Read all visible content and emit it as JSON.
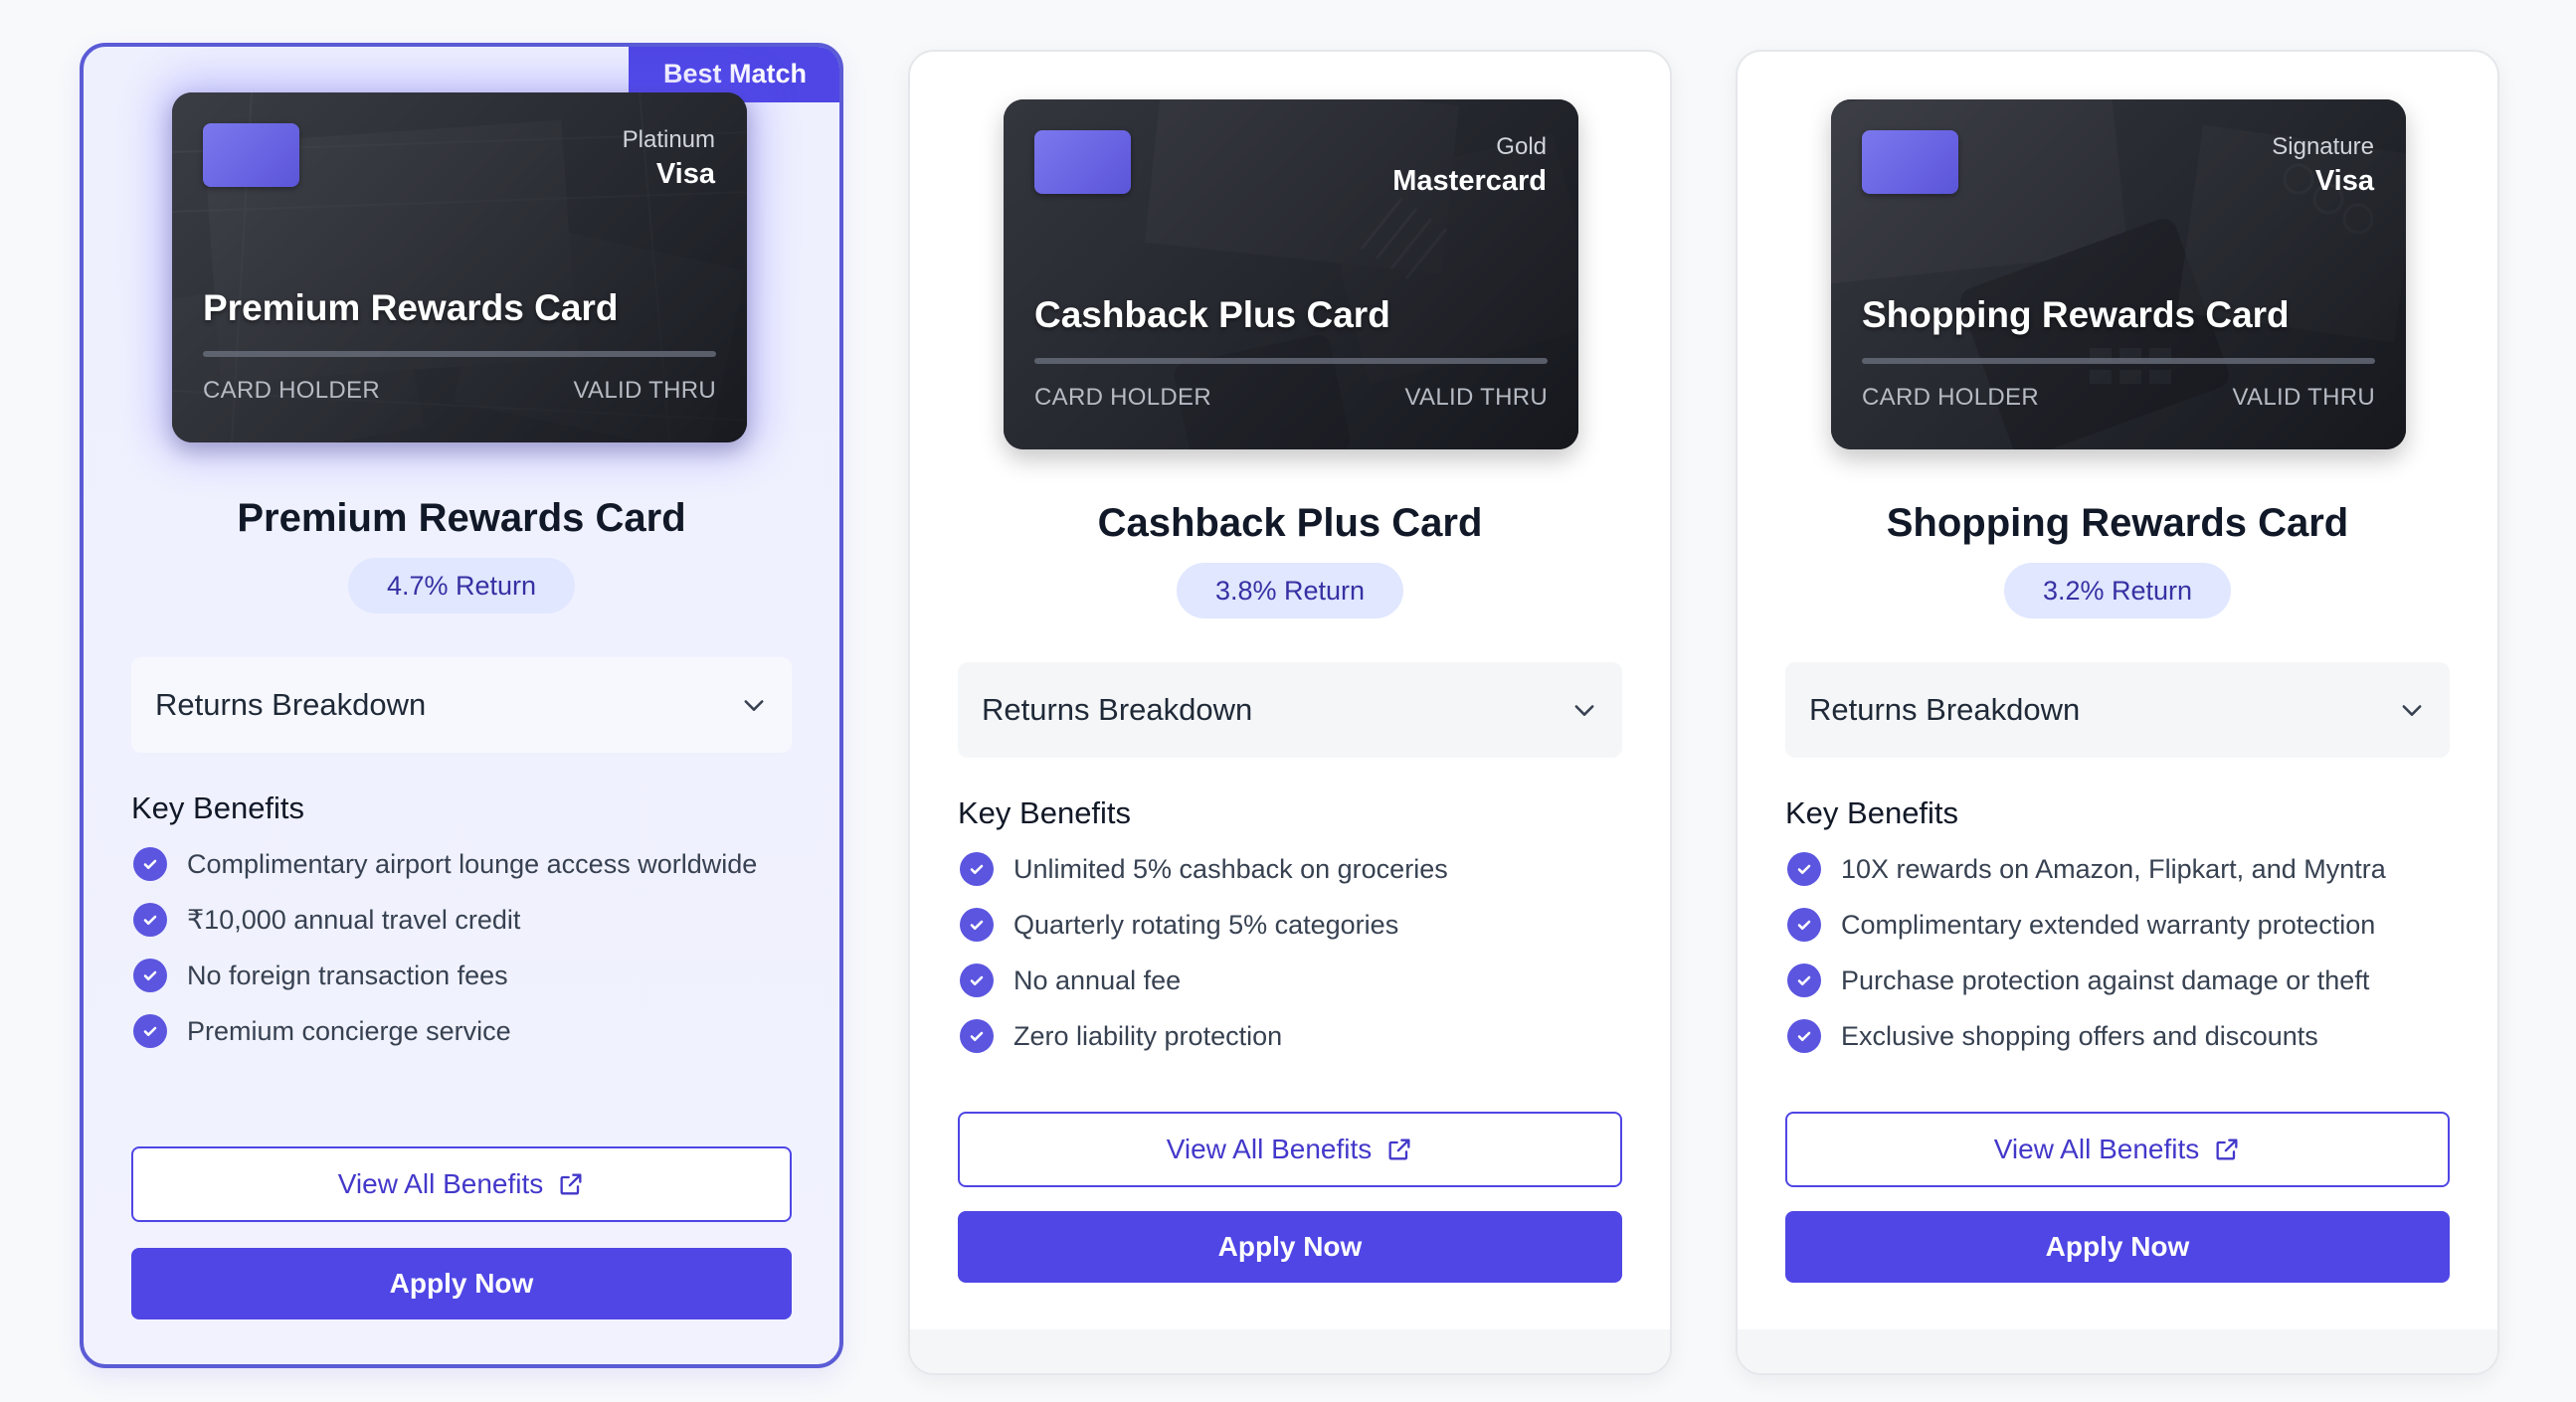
{
  "cards": [
    {
      "best_match_label": "Best Match",
      "tier": "Platinum",
      "network": "Visa",
      "visual_name": "Premium Rewards Card",
      "holder_label": "CARD HOLDER",
      "valid_label": "VALID THRU",
      "title": "Premium Rewards Card",
      "return_label": "4.7% Return",
      "breakdown_label": "Returns Breakdown",
      "benefits_heading": "Key Benefits",
      "benefits": [
        "Complimentary airport lounge access worldwide",
        "₹10,000 annual travel credit",
        "No foreign transaction fees",
        "Premium concierge service"
      ],
      "view_label": "View All Benefits",
      "apply_label": "Apply Now"
    },
    {
      "tier": "Gold",
      "network": "Mastercard",
      "visual_name": "Cashback Plus Card",
      "holder_label": "CARD HOLDER",
      "valid_label": "VALID THRU",
      "title": "Cashback Plus Card",
      "return_label": "3.8% Return",
      "breakdown_label": "Returns Breakdown",
      "benefits_heading": "Key Benefits",
      "benefits": [
        "Unlimited 5% cashback on groceries",
        "Quarterly rotating 5% categories",
        "No annual fee",
        "Zero liability protection"
      ],
      "view_label": "View All Benefits",
      "apply_label": "Apply Now"
    },
    {
      "tier": "Signature",
      "network": "Visa",
      "visual_name": "Shopping Rewards Card",
      "holder_label": "CARD HOLDER",
      "valid_label": "VALID THRU",
      "title": "Shopping Rewards Card",
      "return_label": "3.2% Return",
      "breakdown_label": "Returns Breakdown",
      "benefits_heading": "Key Benefits",
      "benefits": [
        "10X rewards on Amazon, Flipkart, and Myntra",
        "Complimentary extended warranty protection",
        "Purchase protection against damage or theft",
        "Exclusive shopping offers and discounts"
      ],
      "view_label": "View All Benefits",
      "apply_label": "Apply Now"
    }
  ],
  "colors": {
    "accent": "#4f46e5",
    "return_badge_bg": "#e0e7ff",
    "return_badge_text": "#3730a3",
    "check": "#5b55e0"
  },
  "icons": {
    "check": "check-circle-icon",
    "chevron": "chevron-down-icon",
    "external": "external-link-icon"
  }
}
